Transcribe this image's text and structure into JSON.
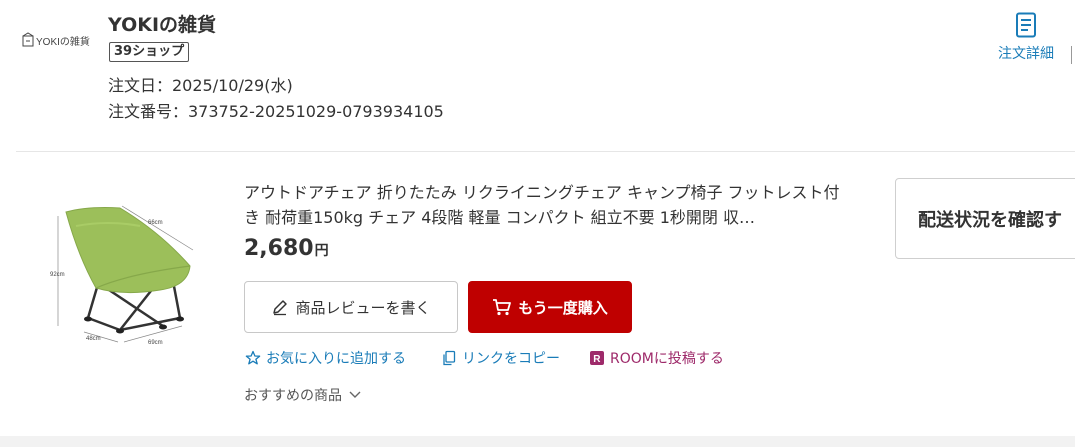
{
  "shop": {
    "logo_text": "YOKIの雑貨",
    "name": "YOKIの雑貨",
    "badge": "39ショップ"
  },
  "order": {
    "date": "注文日：2025/10/29(水)",
    "number": "注文番号：373752-20251029-0793934105",
    "detail_link_label": "注文詳細"
  },
  "product": {
    "title": "アウトドアチェア 折りたたみ リクライニングチェア キャンプ椅子 フットレスト付き 耐荷重150kg チェア 4段階 軽量 コンパクト 組立不要 1秒開閉 収…",
    "price": "2,680",
    "price_unit": "円",
    "image_labels": {
      "depth": "66cm",
      "height": "92cm",
      "width": "69cm",
      "seat": "48cm"
    },
    "chair_color": "#9cbf5a"
  },
  "actions": {
    "review_label": "商品レビューを書く",
    "rebuy_label": "もう一度購入",
    "favorite_label": "お気に入りに追加する",
    "copy_link_label": "リンクをコピー",
    "room_label": "ROOMに投稿する",
    "recommend_label": "おすすめの商品",
    "shipping_label": "配送状況を確認す"
  },
  "colors": {
    "link_blue": "#1a7cb8",
    "primary_red": "#bf0000",
    "room_purple": "#9e2a6a"
  }
}
